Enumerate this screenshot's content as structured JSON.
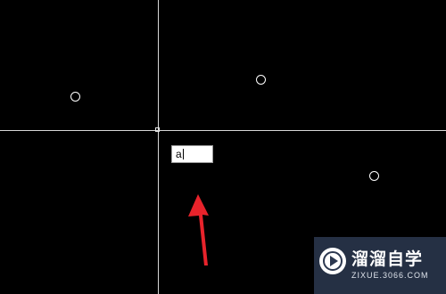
{
  "command_input": {
    "value": "a"
  },
  "colors": {
    "background": "#000000",
    "crosshair": "#d8d8d8",
    "entity": "#ffffff",
    "annotation_arrow": "#e8232b",
    "watermark_bg": "#2c3850"
  },
  "icons": {
    "crosshair": "crosshair-cursor-icon",
    "pickbox": "pickbox-icon",
    "arrow": "red-arrow-icon",
    "logo": "play-logo-icon"
  },
  "watermark": {
    "title": "溜溜自学",
    "url": "ZIXUE.3066.COM"
  }
}
